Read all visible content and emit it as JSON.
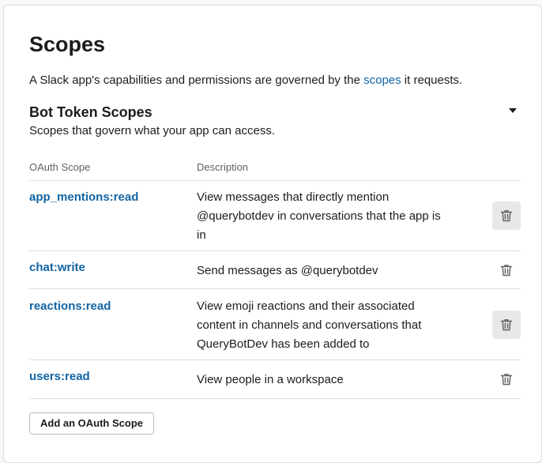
{
  "page": {
    "title": "Scopes",
    "intro_before": "A Slack app's capabilities and permissions are governed by the ",
    "intro_link": "scopes",
    "intro_after": " it requests."
  },
  "section": {
    "title": "Bot Token Scopes",
    "subtitle": "Scopes that govern what your app can access.",
    "toggle_icon": "caret-down-icon"
  },
  "table": {
    "headers": {
      "scope": "OAuth Scope",
      "description": "Description"
    },
    "rows": [
      {
        "scope": "app_mentions:read",
        "description": "View messages that directly mention @querybotdev in conversations that the app is in",
        "delete_icon": "trash-icon"
      },
      {
        "scope": "chat:write",
        "description": "Send messages as @querybotdev",
        "delete_icon": "trash-icon"
      },
      {
        "scope": "reactions:read",
        "description": "View emoji reactions and their associated content in channels and conversations that QueryBotDev has been added to",
        "delete_icon": "trash-icon"
      },
      {
        "scope": "users:read",
        "description": "View people in a workspace",
        "delete_icon": "trash-icon"
      }
    ]
  },
  "add_button": {
    "label": "Add an OAuth Scope"
  },
  "colors": {
    "link": "#1264a3",
    "text": "#1d1c1d",
    "muted": "#616061",
    "border": "#dddddd",
    "icon_hover_bg": "#e8e8e8"
  }
}
